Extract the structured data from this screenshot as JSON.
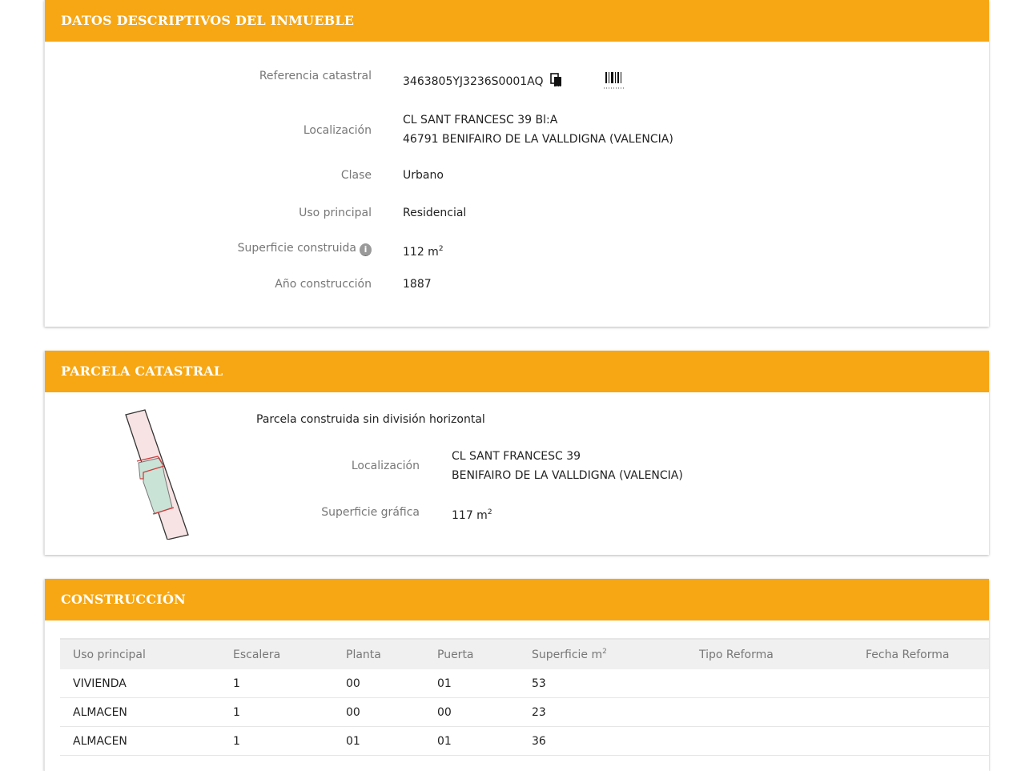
{
  "datos": {
    "header": "DATOS DESCRIPTIVOS DEL INMUEBLE",
    "ref_label": "Referencia catastral",
    "ref_value": "3463805YJ3236S0001AQ",
    "loc_label": "Localización",
    "loc_line1": "CL SANT FRANCESC 39 Bl:A",
    "loc_line2": "46791 BENIFAIRO DE LA VALLDIGNA (VALENCIA)",
    "clase_label": "Clase",
    "clase_value": "Urbano",
    "uso_label": "Uso principal",
    "uso_value": "Residencial",
    "sup_label": "Superficie construida",
    "sup_value": "112 m",
    "sup_sup": "2",
    "anio_label": "Año construcción",
    "anio_value": "1887"
  },
  "parcela": {
    "header": "PARCELA CATASTRAL",
    "subtitle": "Parcela construida sin división horizontal",
    "loc_label": "Localización",
    "loc_line1": "CL SANT FRANCESC 39",
    "loc_line2": "BENIFAIRO DE LA VALLDIGNA (VALENCIA)",
    "sup_label": "Superficie gráfica",
    "sup_value": "117 m",
    "sup_sup": "2"
  },
  "construccion": {
    "header": "CONSTRUCCIÓN",
    "columns": [
      "Uso principal",
      "Escalera",
      "Planta",
      "Puerta",
      "Superficie m",
      "Tipo Reforma",
      "Fecha Reforma"
    ],
    "sup_col_sup": "2",
    "rows": [
      [
        "VIVIENDA",
        "1",
        "00",
        "01",
        "53",
        "",
        ""
      ],
      [
        "ALMACEN",
        "1",
        "00",
        "00",
        "23",
        "",
        ""
      ],
      [
        "ALMACEN",
        "1",
        "01",
        "01",
        "36",
        "",
        ""
      ]
    ]
  },
  "icons": {
    "copy": "copy-icon",
    "barcode": "barcode-icon",
    "info": "info-icon",
    "parcel_map": "parcel-map"
  },
  "colors": {
    "header_bg": "#f7a713",
    "parcel_fill": "#c9e3d6",
    "parcel_outline": "#d23c3c"
  }
}
